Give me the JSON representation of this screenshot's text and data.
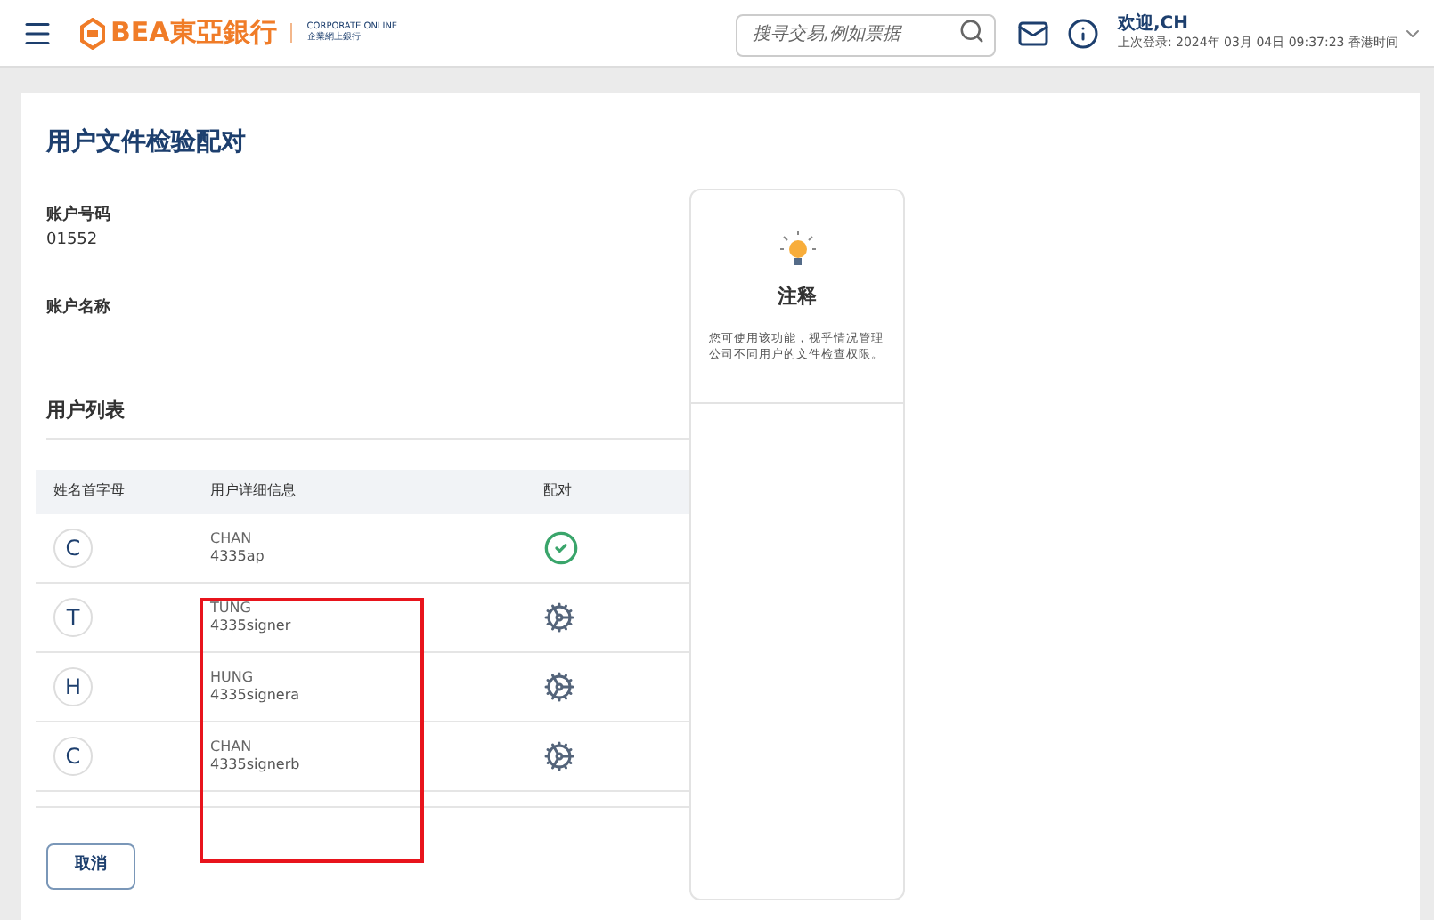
{
  "header": {
    "logo_text": "BEA東亞銀行",
    "product_en": "CORPORATE ONLINE",
    "product_zh": "企業網上銀行",
    "search": {
      "placeholder": "搜寻交易,例如票据"
    },
    "welcome": "欢迎,CH",
    "last_login": "上次登录: 2024年 03月 04日 09:37:23 香港时间"
  },
  "page_title": "用户文件检验配对",
  "account": [
    {
      "label": "账户号码",
      "value": "01552"
    },
    {
      "label": "账户名称"
    }
  ],
  "note": {
    "title": "注释",
    "text": "您可使用该功能，视乎情况管理公司不同用户的文件检查权限。"
  },
  "user_list": {
    "title": "用户列表",
    "columns": [
      "姓名首字母",
      "用户详细信息",
      "配对"
    ],
    "rows": [
      {
        "initial": "C",
        "name": "CHAN",
        "user_id": "4335ap",
        "matched": true
      },
      {
        "initial": "T",
        "name": "TUNG",
        "user_id": "4335signer",
        "matched": false
      },
      {
        "initial": "H",
        "name": "HUNG",
        "user_id": "4335signera",
        "matched": false
      },
      {
        "initial": "C",
        "name": "CHAN",
        "user_id": "4335signerb",
        "matched": false
      }
    ]
  },
  "cancel_button": "取消"
}
